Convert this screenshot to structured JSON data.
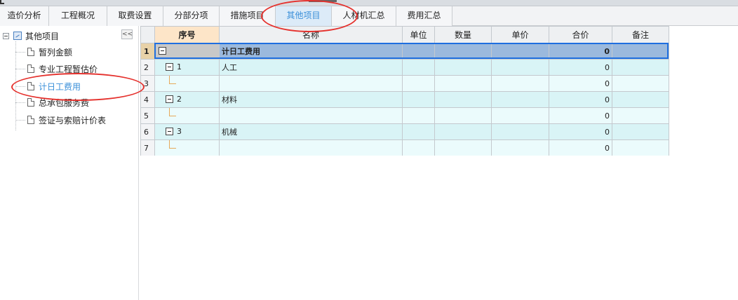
{
  "tabs": [
    {
      "label": "造价分析",
      "active": false
    },
    {
      "label": "工程概况",
      "active": false
    },
    {
      "label": "取费设置",
      "active": false
    },
    {
      "label": "分部分项",
      "active": false
    },
    {
      "label": "措施项目",
      "active": false
    },
    {
      "label": "其他项目",
      "active": true
    },
    {
      "label": "人材机汇总",
      "active": false
    },
    {
      "label": "费用汇总",
      "active": false
    }
  ],
  "sidebar": {
    "root_label": "其他项目",
    "collapse_glyph": "<<",
    "items": [
      {
        "label": "暂列金额"
      },
      {
        "label": "专业工程暂估价"
      },
      {
        "label": "计日工费用",
        "selected": true
      },
      {
        "label": "总承包服务费"
      },
      {
        "label": "签证与索赔计价表"
      }
    ]
  },
  "grid": {
    "columns": [
      "序号",
      "名称",
      "单位",
      "数量",
      "单价",
      "合价",
      "备注"
    ],
    "rows": [
      {
        "num": "1",
        "seq": "",
        "name": "计日工费用",
        "unit": "",
        "qty": "",
        "price": "",
        "total": "0",
        "note": ""
      },
      {
        "num": "2",
        "seq": "1",
        "name": "人工",
        "unit": "",
        "qty": "",
        "price": "",
        "total": "0",
        "note": ""
      },
      {
        "num": "3",
        "seq": "",
        "name": "",
        "unit": "",
        "qty": "",
        "price": "",
        "total": "0",
        "note": ""
      },
      {
        "num": "4",
        "seq": "2",
        "name": "材料",
        "unit": "",
        "qty": "",
        "price": "",
        "total": "0",
        "note": ""
      },
      {
        "num": "5",
        "seq": "",
        "name": "",
        "unit": "",
        "qty": "",
        "price": "",
        "total": "0",
        "note": ""
      },
      {
        "num": "6",
        "seq": "3",
        "name": "机械",
        "unit": "",
        "qty": "",
        "price": "",
        "total": "0",
        "note": ""
      },
      {
        "num": "7",
        "seq": "",
        "name": "",
        "unit": "",
        "qty": "",
        "price": "",
        "total": "0",
        "note": ""
      }
    ]
  },
  "colors": {
    "accent": "#3a8fd9",
    "selected_row": "#9bb9dd",
    "row_even": "#d9f4f6",
    "row_odd": "#ebfbfc",
    "annotation": "#e5312d"
  }
}
